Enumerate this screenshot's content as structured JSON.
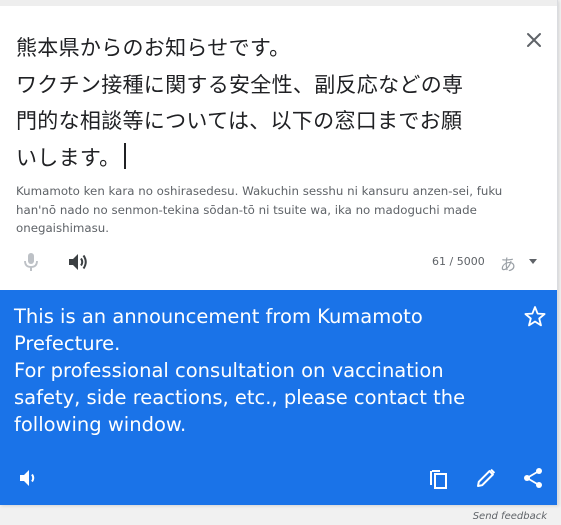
{
  "source": {
    "text": "熊本県からのお知らせです。\nワクチン接種に関する安全性、副反応などの専門的な相談等については、以下の窓口までお願いします。",
    "lines": [
      "熊本県からのお知らせです。",
      "ワクチン接種に関する安全性、副反応などの専",
      "門的な相談等については、以下の窓口までお願",
      "いします。"
    ],
    "transliteration": "Kumamoto ken kara no oshirasedesu. Wakuchin sesshu ni kansuru anzen-sei, fuku han'nō nado no senmon-tekina sōdan-tō ni tsuite wa, ika no madoguchi made onegaishimasu.",
    "char_count": "61 / 5000",
    "input_method": "あ"
  },
  "result": {
    "text": "This is an announcement from Kumamoto Prefecture.\nFor professional consultation on vaccination safety, side reactions, etc., please contact the following window."
  },
  "footer": {
    "feedback_label": "Send feedback"
  },
  "icons": {
    "close": "close-icon",
    "mic": "mic-icon",
    "speaker": "speaker-icon",
    "ime": "input-method-icon",
    "star": "star-icon",
    "copy": "copy-icon",
    "edit": "edit-icon",
    "share": "share-icon"
  },
  "colors": {
    "result_background": "#1a73e8",
    "source_text": "#202124",
    "secondary_text": "#5f6368",
    "disabled_icon": "#bdc1c6"
  }
}
